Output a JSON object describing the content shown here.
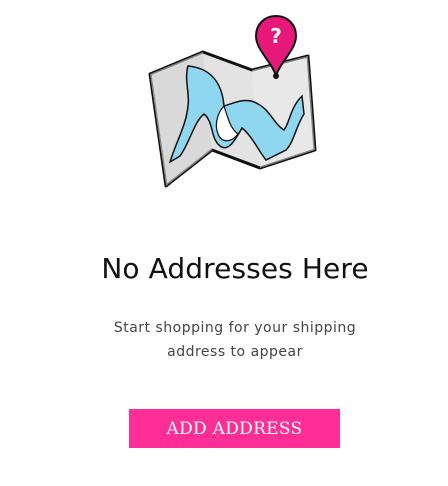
{
  "empty_state": {
    "title": "No Addresses Here",
    "subtitle_line1": "Start shopping for your shipping",
    "subtitle_line2": "address to appear",
    "button_label": "ADD ADDRESS",
    "illustration": {
      "icon": "map-with-question-pin-icon",
      "pin_symbol": "?"
    }
  },
  "colors": {
    "accent": "#ff2d96",
    "map_water": "#8fd6f0",
    "map_land": "#e2e2e2",
    "outline": "#111111"
  }
}
